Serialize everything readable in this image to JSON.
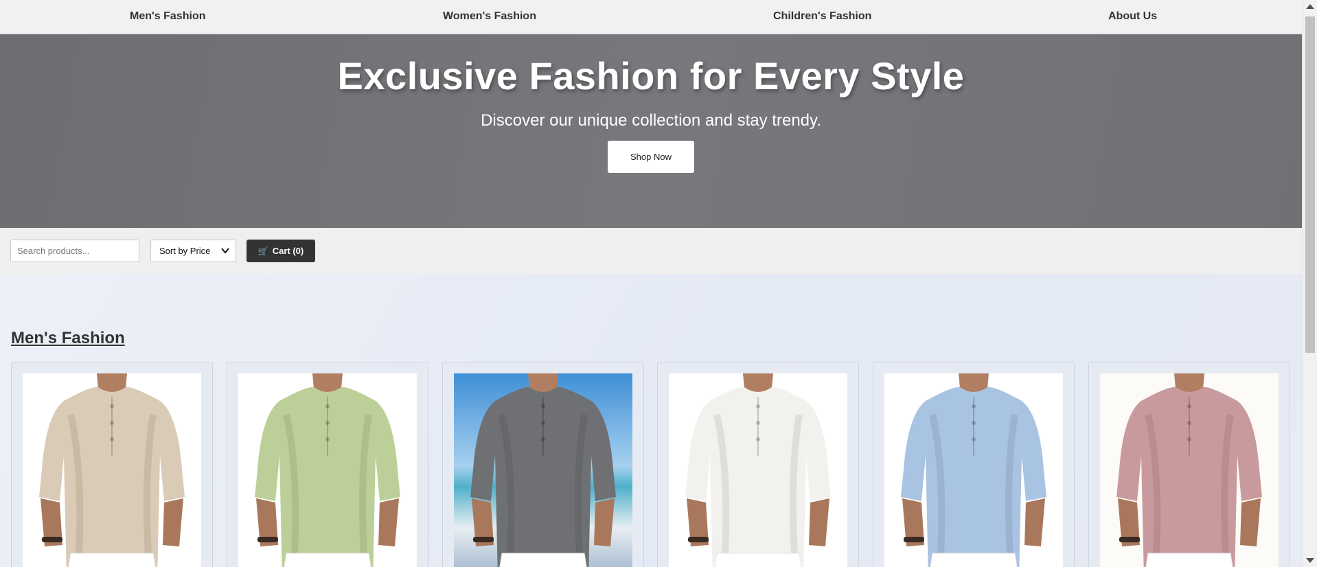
{
  "nav": {
    "items": [
      {
        "label": "Men's Fashion"
      },
      {
        "label": "Women's Fashion"
      },
      {
        "label": "Children's Fashion"
      },
      {
        "label": "About Us"
      }
    ]
  },
  "hero": {
    "title": "Exclusive Fashion for Every Style",
    "subtitle": "Discover our unique collection and stay trendy.",
    "cta_label": "Shop Now"
  },
  "controls": {
    "search_placeholder": "Search products...",
    "sort_label": "Sort by Price",
    "cart_label": "Cart (0)",
    "cart_icon": "cart-icon"
  },
  "section": {
    "title": "Men's Fashion",
    "products": [
      {
        "image": "beige-henley-shirt",
        "shirt_color": "#d9cbb5",
        "background": "#ffffff"
      },
      {
        "image": "green-henley-shirt",
        "shirt_color": "#bccf98",
        "background": "#ffffff"
      },
      {
        "image": "gray-henley-shirt-beach",
        "shirt_color": "#6e7073",
        "background": "beach"
      },
      {
        "image": "white-henley-shirt",
        "shirt_color": "#f2f1ee",
        "background": "#ffffff"
      },
      {
        "image": "light-blue-henley-shirt",
        "shirt_color": "#a9c3e3",
        "background": "#ffffff"
      },
      {
        "image": "pink-henley-shirt",
        "shirt_color": "#c99a9d",
        "background": "#fdfbf7"
      }
    ]
  }
}
